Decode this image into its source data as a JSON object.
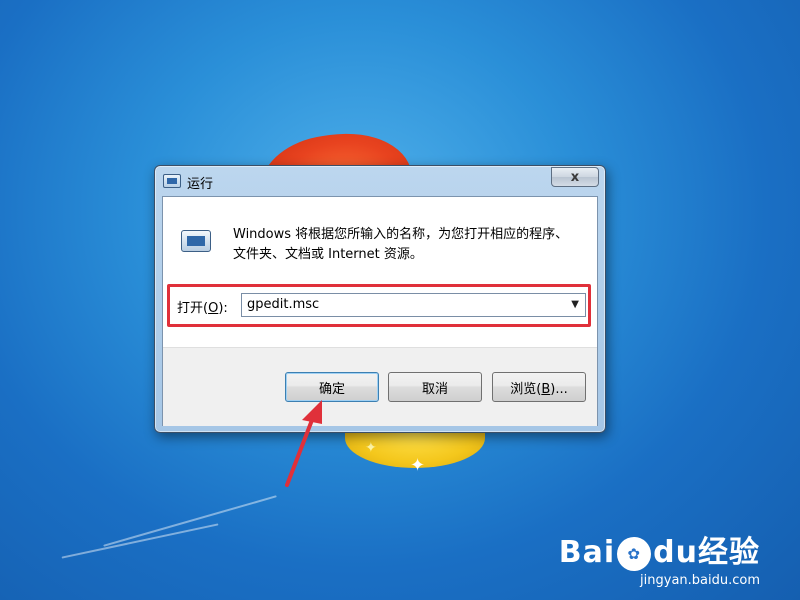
{
  "dialog": {
    "title": "运行",
    "close_label": "x",
    "description_line1": "Windows 将根据您所输入的名称，为您打开相应的程序、",
    "description_line2": "文件夹、文档或 Internet 资源。",
    "open_label_prefix": "打开(",
    "open_label_key": "O",
    "open_label_suffix": "):",
    "open_value": "gpedit.msc",
    "buttons": {
      "ok": "确定",
      "cancel": "取消",
      "browse_prefix": "浏览(",
      "browse_key": "B",
      "browse_suffix": ")..."
    }
  },
  "watermark": {
    "brand_a": "Bai",
    "brand_b": "du",
    "brand_c": "经验",
    "url": "jingyan.baidu.com"
  },
  "colors": {
    "highlight": "#e0303a",
    "arrow": "#e0303a",
    "desktop": "#2a8fd8"
  },
  "icons": [
    "close-icon",
    "program-icon",
    "dropdown-arrow-icon",
    "annotation-arrow"
  ]
}
